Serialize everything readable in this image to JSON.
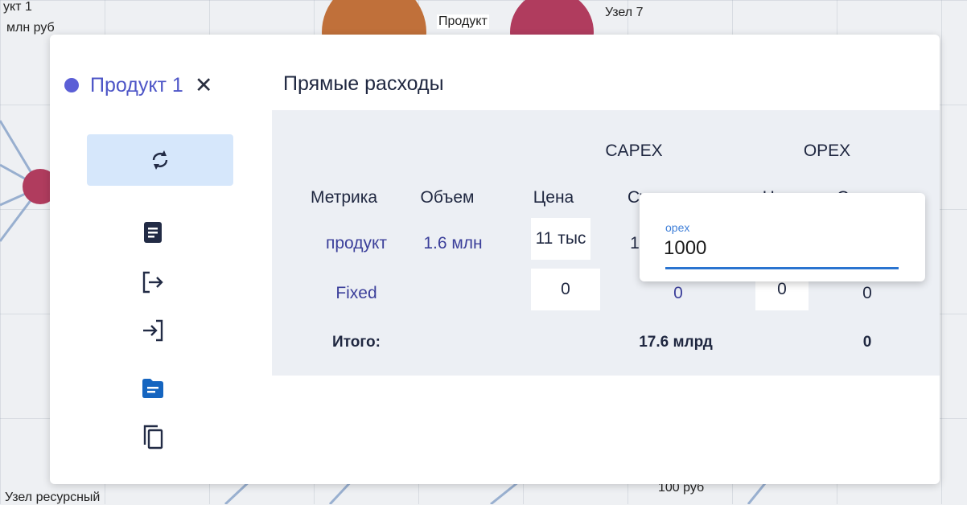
{
  "background": {
    "labels": [
      "укт 1",
      "млн руб",
      "Продукт",
      "Узел 7",
      "Узел ресурсный",
      "100 руб"
    ],
    "colors": {
      "orange_node": "#c0703a",
      "red_node": "#b03c5e",
      "edge": "#8fa8cc"
    }
  },
  "modal": {
    "product": {
      "name": "Продукт 1",
      "dot_color": "#5b5fd6"
    },
    "close_icon": "close-icon",
    "section_title": "Прямые расходы"
  },
  "sidebar": {
    "items": [
      {
        "name": "sync-icon",
        "active": true
      },
      {
        "name": "document-icon"
      },
      {
        "name": "export-icon"
      },
      {
        "name": "import-icon"
      },
      {
        "name": "folder-icon",
        "color": "#1565c0"
      },
      {
        "name": "copy-icon"
      }
    ]
  },
  "table": {
    "group_headers": [
      "CAPEX",
      "OPEX"
    ],
    "columns": [
      "Метрика",
      "Объем",
      "Цена",
      "Сумма",
      "Цена",
      "Сумма"
    ],
    "rows": [
      {
        "metric": "продукт",
        "volume": "1.6 млн",
        "capex_price": "11 тыс",
        "capex_sum": "1"
      },
      {
        "metric": "Fixed",
        "volume": "",
        "capex_price": "0",
        "capex_sum": "0",
        "opex_price": "0",
        "opex_sum": "0"
      }
    ],
    "total": {
      "label": "Итого:",
      "capex_sum": "17.6 млрд",
      "opex_sum": "0"
    }
  },
  "editor": {
    "label": "opex",
    "value": "1000"
  }
}
